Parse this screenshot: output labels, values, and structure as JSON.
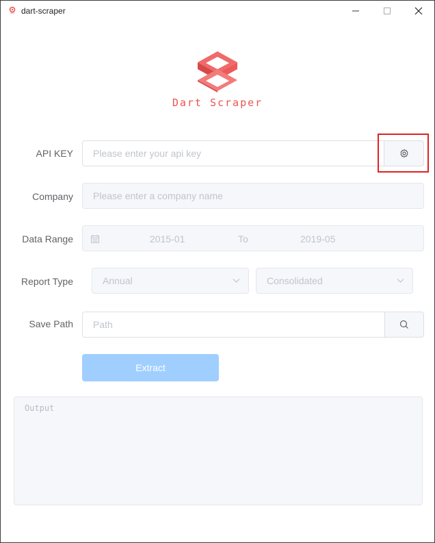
{
  "window": {
    "title": "dart-scraper",
    "icon": "app-logo-icon"
  },
  "brand": {
    "name": "Dart Scraper",
    "color": "#e85550"
  },
  "form": {
    "api_key": {
      "label": "API KEY",
      "placeholder": "Please enter your api key",
      "button_icon": "gear-icon"
    },
    "company": {
      "label": "Company",
      "placeholder": "Please enter a company name"
    },
    "date_range": {
      "label": "Data Range",
      "icon": "calendar-icon",
      "start": "2015-01",
      "separator": "To",
      "end": "2019-05"
    },
    "report_type": {
      "label": "Report Type",
      "period": "Annual",
      "scope": "Consolidated"
    },
    "save_path": {
      "label": "Save Path",
      "placeholder": "Path",
      "button_icon": "search-icon"
    },
    "extract_label": "Extract"
  },
  "output": {
    "placeholder": "Output"
  },
  "colors": {
    "primary_light": "#a0cfff",
    "highlight": "#e02020"
  }
}
